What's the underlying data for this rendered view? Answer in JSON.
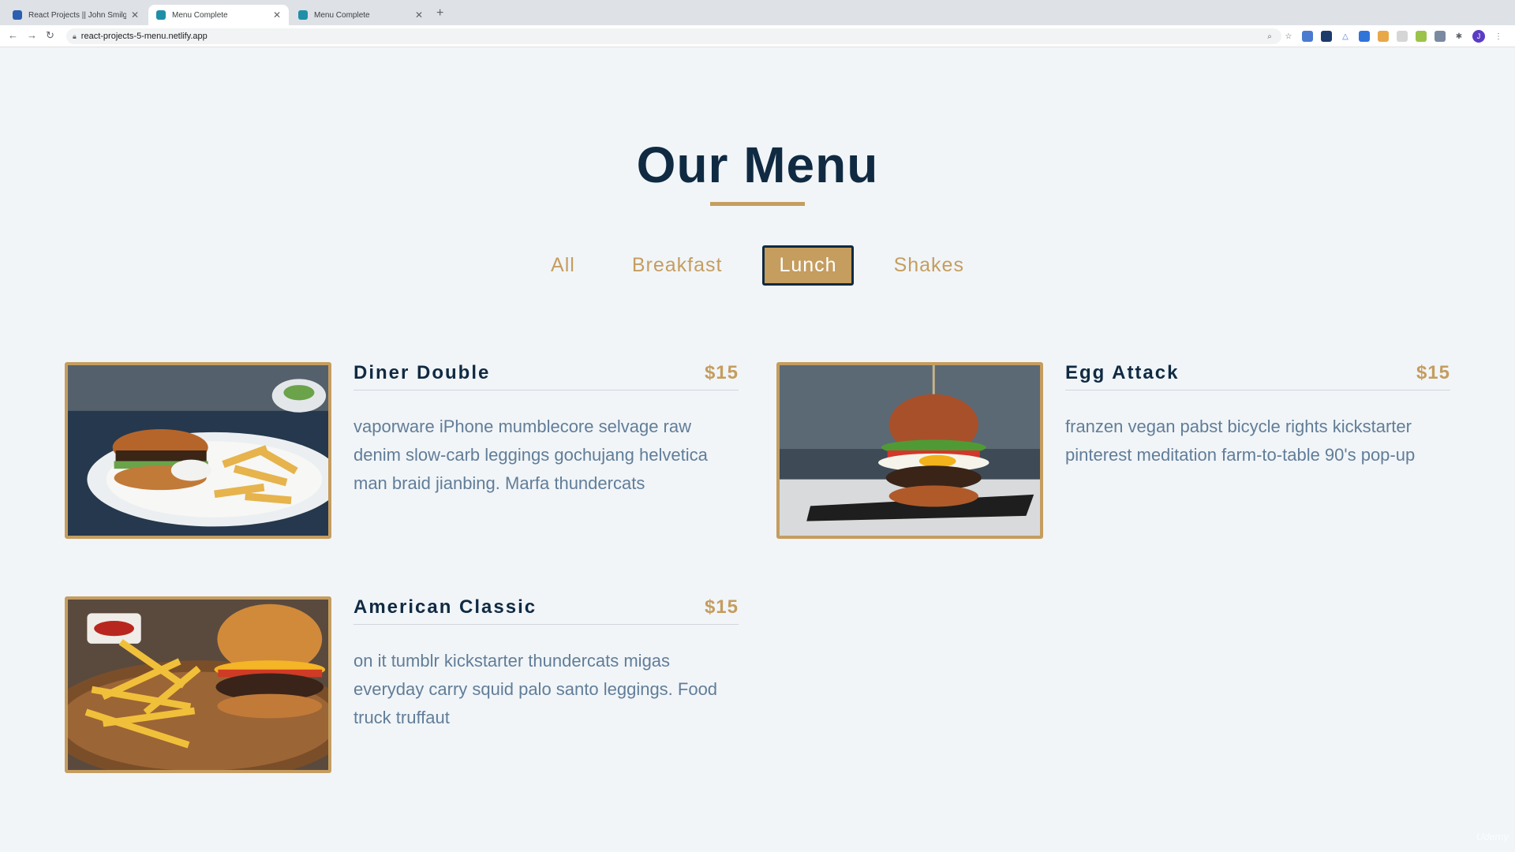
{
  "browser": {
    "tabs": [
      {
        "title": "React Projects || John Smilga",
        "active": false
      },
      {
        "title": "Menu Complete",
        "active": true
      },
      {
        "title": "Menu Complete",
        "active": false
      }
    ],
    "new_tab_icon": "+",
    "url": "react-projects-5-menu.netlify.app",
    "extension_icons": [
      "zoom-icon",
      "star-icon",
      "extension-1-icon",
      "extension-2-icon",
      "extension-3-icon",
      "extension-4-icon",
      "extension-5-icon",
      "extension-6-icon",
      "extension-7-icon",
      "extension-8-icon",
      "puzzle-icon"
    ],
    "profile_initial": "J"
  },
  "page": {
    "title": "Our Menu",
    "accent_color": "#c59d5f",
    "heading_color": "#102a42",
    "filters": [
      {
        "label": "All",
        "active": false
      },
      {
        "label": "Breakfast",
        "active": false
      },
      {
        "label": "Lunch",
        "active": true
      },
      {
        "label": "Shakes",
        "active": false
      }
    ],
    "items": [
      {
        "name": "Diner Double",
        "price": "$15",
        "desc": "vaporware iPhone mumblecore selvage raw denim slow-carb leggings gochujang helvetica man braid jianbing. Marfa thundercats",
        "image": "burger-fries-plate-photo"
      },
      {
        "name": "Egg Attack",
        "price": "$15",
        "desc": "franzen vegan pabst bicycle rights kickstarter pinterest meditation farm-to-table 90's pop-up",
        "image": "egg-burger-photo"
      },
      {
        "name": "American Classic",
        "price": "$15",
        "desc": "on it tumblr kickstarter thundercats migas everyday carry squid palo santo leggings. Food truck truffaut",
        "image": "cheeseburger-fries-board-photo"
      }
    ]
  },
  "watermark": "Udemy"
}
